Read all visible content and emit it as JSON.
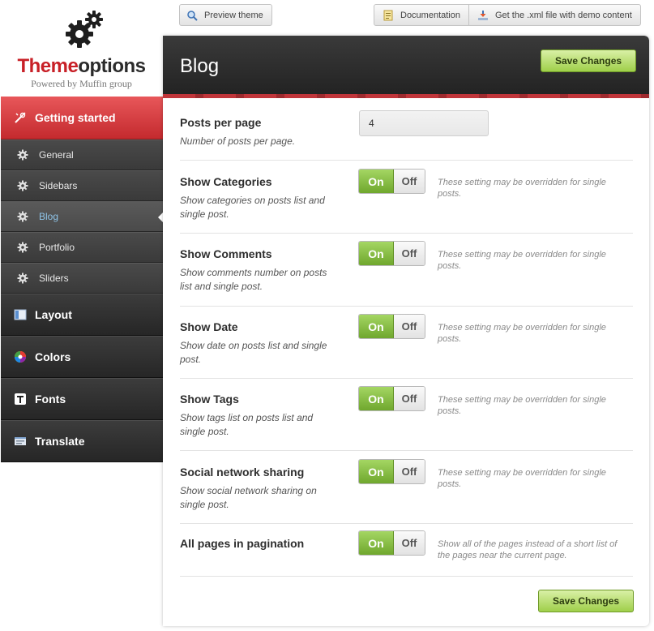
{
  "logo": {
    "word_part1": "Theme",
    "word_part2": "options",
    "powered_by": "Powered by Muffin group",
    "icon": "gears-icon"
  },
  "topbar": {
    "preview_label": "Preview theme",
    "documentation_label": "Documentation",
    "xml_label": "Get the .xml file with demo content"
  },
  "sidebar": {
    "active_section": {
      "label": "Getting started",
      "icon": "tools-icon"
    },
    "sub_items": [
      {
        "label": "General",
        "icon": "gear-icon"
      },
      {
        "label": "Sidebars",
        "icon": "gear-icon"
      },
      {
        "label": "Blog",
        "icon": "gear-icon",
        "active": true
      },
      {
        "label": "Portfolio",
        "icon": "gear-icon"
      },
      {
        "label": "Sliders",
        "icon": "gear-icon"
      }
    ],
    "sections": [
      {
        "label": "Layout",
        "icon": "layout-icon"
      },
      {
        "label": "Colors",
        "icon": "color-wheel-icon"
      },
      {
        "label": "Fonts",
        "icon": "font-icon"
      },
      {
        "label": "Translate",
        "icon": "translate-icon"
      }
    ]
  },
  "main": {
    "title": "Blog",
    "save_label": "Save Changes",
    "posts_per_page": {
      "title": "Posts per page",
      "desc": "Number of posts per page.",
      "value": "4"
    },
    "toggles": [
      {
        "title": "Show Categories",
        "desc": "Show categories on posts list and single post.",
        "note": "These setting may be overridden for single posts.",
        "on_label": "On",
        "off_label": "Off",
        "state": "on"
      },
      {
        "title": "Show Comments",
        "desc": "Show comments number on posts list and single post.",
        "note": "These setting may be overridden for single posts.",
        "on_label": "On",
        "off_label": "Off",
        "state": "on"
      },
      {
        "title": "Show Date",
        "desc": "Show date on posts list and single post.",
        "note": "These setting may be overridden for single posts.",
        "on_label": "On",
        "off_label": "Off",
        "state": "on"
      },
      {
        "title": "Show Tags",
        "desc": "Show tags list on posts list and single post.",
        "note": "These setting may be overridden for single posts.",
        "on_label": "On",
        "off_label": "Off",
        "state": "on"
      },
      {
        "title": "Social network sharing",
        "desc": "Show social network sharing on single post.",
        "note": "These setting may be overridden for single posts.",
        "on_label": "On",
        "off_label": "Off",
        "state": "on"
      },
      {
        "title": "All pages in pagination",
        "desc": "",
        "note": "Show all of the pages instead of a short list of the pages near the current page.",
        "on_label": "On",
        "off_label": "Off",
        "state": "on"
      }
    ]
  },
  "colors": {
    "accent_red": "#c82027",
    "toggle_green": "#7fb637",
    "sidebar_dark": "#2f2f2f"
  }
}
